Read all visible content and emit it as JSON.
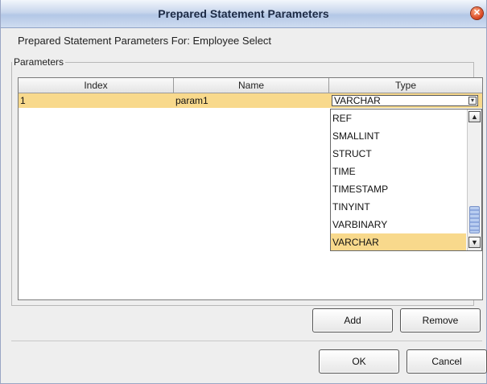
{
  "dialog": {
    "title": "Prepared Statement Parameters",
    "close_symbol": "✕",
    "subtitle": "Prepared Statement Parameters For:  Employee Select"
  },
  "params": {
    "legend": "Parameters",
    "columns": [
      "Index",
      "Name",
      "Type"
    ],
    "rows": [
      {
        "index": "1",
        "name": "param1",
        "type": "VARCHAR"
      }
    ]
  },
  "type_dropdown": {
    "options": [
      "REF",
      "SMALLINT",
      "STRUCT",
      "TIME",
      "TIMESTAMP",
      "TINYINT",
      "VARBINARY",
      "VARCHAR"
    ],
    "selected": "VARCHAR"
  },
  "buttons": {
    "add": "Add",
    "remove": "Remove",
    "ok": "OK",
    "cancel": "Cancel"
  },
  "icons": {
    "close": "close-icon",
    "combo_arrow": "chevron-down-icon",
    "scroll_up": "arrow-up-icon",
    "scroll_down": "arrow-down-icon"
  },
  "colors": {
    "selection": "#f8d98c",
    "title_gradient": "#b3c7e6"
  }
}
